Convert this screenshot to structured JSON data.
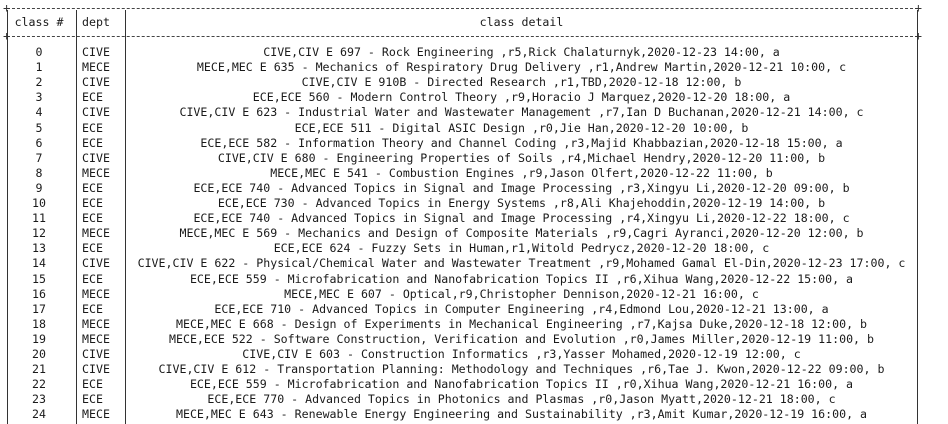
{
  "table": {
    "headers": {
      "idx": "class #",
      "dept": "dept",
      "detail": "class detail"
    },
    "rows": [
      {
        "idx": "0",
        "dept": "CIVE",
        "detail": "CIVE,CIV E 697 - Rock Engineering ,r5,Rick Chalaturnyk,2020-12-23 14:00, a"
      },
      {
        "idx": "1",
        "dept": "MECE",
        "detail": "MECE,MEC E 635 - Mechanics of Respiratory Drug Delivery ,r1,Andrew Martin,2020-12-21 10:00, c"
      },
      {
        "idx": "2",
        "dept": "CIVE",
        "detail": "CIVE,CIV E 910B - Directed Research ,r1,TBD,2020-12-18 12:00, b"
      },
      {
        "idx": "3",
        "dept": "ECE",
        "detail": "ECE,ECE 560 - Modern Control Theory ,r9,Horacio J Marquez,2020-12-20 18:00, a"
      },
      {
        "idx": "4",
        "dept": "CIVE",
        "detail": "CIVE,CIV E 623 - Industrial Water and Wastewater Management ,r7,Ian D Buchanan,2020-12-21 14:00, c"
      },
      {
        "idx": "5",
        "dept": "ECE",
        "detail": "ECE,ECE 511 - Digital ASIC Design ,r0,Jie Han,2020-12-20 10:00, b"
      },
      {
        "idx": "6",
        "dept": "ECE",
        "detail": "ECE,ECE 582 - Information Theory and Channel Coding ,r3,Majid Khabbazian,2020-12-18 15:00, a"
      },
      {
        "idx": "7",
        "dept": "CIVE",
        "detail": "CIVE,CIV E 680 - Engineering Properties of Soils ,r4,Michael Hendry,2020-12-20 11:00, b"
      },
      {
        "idx": "8",
        "dept": "MECE",
        "detail": "MECE,MEC E 541 - Combustion Engines ,r9,Jason Olfert,2020-12-22 11:00, b"
      },
      {
        "idx": "9",
        "dept": "ECE",
        "detail": "ECE,ECE 740 - Advanced Topics in Signal and Image Processing ,r3,Xingyu Li,2020-12-20 09:00, b"
      },
      {
        "idx": "10",
        "dept": "ECE",
        "detail": "ECE,ECE 730 - Advanced Topics in Energy Systems ,r8,Ali Khajehoddin,2020-12-19 14:00, b"
      },
      {
        "idx": "11",
        "dept": "ECE",
        "detail": "ECE,ECE 740 - Advanced Topics in Signal and Image Processing ,r4,Xingyu Li,2020-12-22 18:00, c"
      },
      {
        "idx": "12",
        "dept": "MECE",
        "detail": "MECE,MEC E 569 - Mechanics and Design of Composite Materials ,r9,Cagri Ayranci,2020-12-20 12:00, b"
      },
      {
        "idx": "13",
        "dept": "ECE",
        "detail": "ECE,ECE 624 - Fuzzy Sets in Human,r1,Witold Pedrycz,2020-12-20 18:00, c"
      },
      {
        "idx": "14",
        "dept": "CIVE",
        "detail": "CIVE,CIV E 622 - Physical/Chemical Water and Wastewater Treatment ,r9,Mohamed Gamal El-Din,2020-12-23 17:00, c"
      },
      {
        "idx": "15",
        "dept": "ECE",
        "detail": "ECE,ECE 559 - Microfabrication and Nanofabrication Topics II ,r6,Xihua Wang,2020-12-22 15:00, a"
      },
      {
        "idx": "16",
        "dept": "MECE",
        "detail": "MECE,MEC E 607 - Optical,r9,Christopher Dennison,2020-12-21 16:00, c"
      },
      {
        "idx": "17",
        "dept": "ECE",
        "detail": "ECE,ECE 710 - Advanced Topics in Computer Engineering ,r4,Edmond Lou,2020-12-21 13:00, a"
      },
      {
        "idx": "18",
        "dept": "MECE",
        "detail": "MECE,MEC E 668 - Design of Experiments in Mechanical Engineering ,r7,Kajsa Duke,2020-12-18 12:00, b"
      },
      {
        "idx": "19",
        "dept": "MECE",
        "detail": "MECE,ECE 522 - Software Construction, Verification and Evolution ,r0,James Miller,2020-12-19 11:00, b"
      },
      {
        "idx": "20",
        "dept": "CIVE",
        "detail": "CIVE,CIV E 603 - Construction Informatics ,r3,Yasser Mohamed,2020-12-19 12:00, c"
      },
      {
        "idx": "21",
        "dept": "CIVE",
        "detail": "CIVE,CIV E 612 - Transportation Planning: Methodology and Techniques ,r6,Tae J. Kwon,2020-12-22 09:00, b"
      },
      {
        "idx": "22",
        "dept": "ECE",
        "detail": "ECE,ECE 559 - Microfabrication and Nanofabrication Topics II ,r0,Xihua Wang,2020-12-21 16:00, a"
      },
      {
        "idx": "23",
        "dept": "ECE",
        "detail": "ECE,ECE 770 - Advanced Topics in Photonics and Plasmas ,r0,Jason Myatt,2020-12-21 18:00, c"
      },
      {
        "idx": "24",
        "dept": "MECE",
        "detail": "MECE,MEC E 643 - Renewable Energy Engineering and Sustainability ,r3,Amit Kumar,2020-12-19 16:00, a"
      }
    ]
  }
}
